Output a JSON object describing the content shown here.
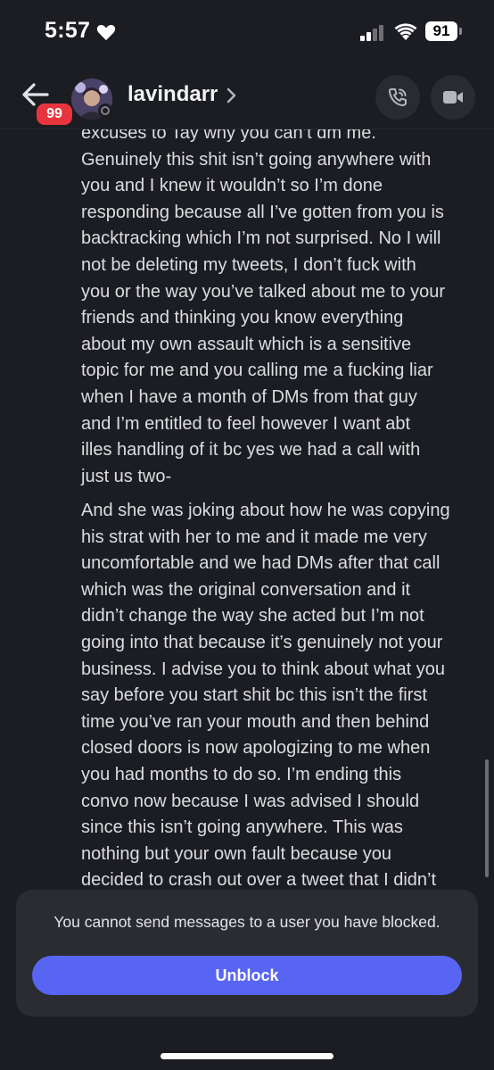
{
  "status_bar": {
    "time": "5:57",
    "battery": "91"
  },
  "header": {
    "unread_badge": "99",
    "username": "lavindarr",
    "icons": [
      "back-arrow-icon",
      "chevron-right-icon",
      "phone-call-icon",
      "video-camera-icon"
    ]
  },
  "messages": [
    {
      "text": "excuses to Tay why you can’t dm me.\nGenuinely this shit isn’t going anywhere with\nyou and I knew it wouldn’t so I’m done\nresponding because all I’ve gotten from you is\nbacktracking which I’m not surprised. No I will\nnot be deleting my tweets, I don’t fuck with\nyou or the way you’ve talked about me to your\nfriends and thinking you know everything\nabout my own assault which is a sensitive\ntopic for me and you calling me a fucking liar\nwhen I have a month of DMs from that guy\nand I’m entitled to feel however I want abt\nilles handling of it bc yes we had a call with\njust us two-"
    },
    {
      "text": "And she was joking about how he was copying\nhis strat with her to me and it made me very\nuncomfortable and we had DMs after that call\nwhich was the original conversation and it\ndidn’t change the way she acted but I’m not\ngoing into that because it’s genuinely not your\nbusiness. I advise you to think about what you\nsay before you start shit bc this isn’t the first\ntime you’ve ran your mouth and then behind\nclosed doors is now apologizing to me when\nyou had months to do so. I’m ending this\nconvo now because I was advised I should\nsince this isn’t going anywhere. This was\nnothing but your own fault because you\ndecided to crash out over a tweet that I didn’t"
    }
  ],
  "blocked_notice": {
    "text": "You cannot send messages to a user you have blocked.",
    "button_label": "Unblock"
  },
  "colors": {
    "background": "#1c1d22",
    "panel": "#2b2c32",
    "accent": "#5865f2",
    "badge": "#e8343d"
  }
}
